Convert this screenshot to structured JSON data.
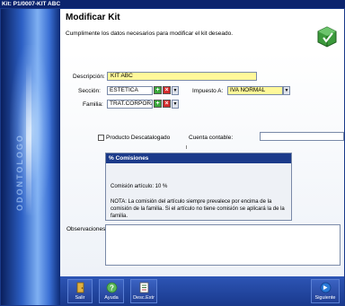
{
  "window": {
    "title": "Kit: P1/0007-KIT ABC"
  },
  "side_panel": {
    "watermark": "ODONTOLOGO"
  },
  "header": {
    "title": "Modificar Kit",
    "subtitle": "Cumplimente los datos necesarios para modificar el kit deseado."
  },
  "form": {
    "descripcion_label": "Descripción:",
    "descripcion_value": "KIT ABC",
    "seccion_label": "Sección:",
    "seccion_value": "ESTETICA",
    "impuesto_label": "Impuesto A:",
    "impuesto_value": "IVA NORMAL",
    "familia_label": "Familia:",
    "familia_value": "TRAT.CORPORAL",
    "descatalogado_label": "Producto Descatalogado",
    "descatalogado_checked": false,
    "cuenta_label": "Cuenta contable:",
    "cuenta_value": ""
  },
  "comisiones": {
    "title": "% Comisiones",
    "line": "Comisión artículo: 10 %",
    "note": "NOTA: La comisión del artículo siempre prevalece por encima de la comisión de la familia. Si el artículo no tiene comisión se aplicará la de la familia."
  },
  "observaciones": {
    "label": "Observaciones",
    "value": ""
  },
  "toolbar": {
    "salir_label": "Salir",
    "ayuda_label": "Ayuda",
    "desc_label": "Desc.Extr",
    "siguiente_label": "Siguiente"
  },
  "colors": {
    "accent_header": "#1b3a8a",
    "required_field": "#fff89a",
    "add": "#3aa63a",
    "delete": "#d22b2b"
  },
  "icons": [
    "kit-icon",
    "user-icon",
    "add-icon",
    "delete-icon",
    "dropdown-icon",
    "exit-door-icon",
    "help-icon",
    "document-list-icon",
    "next-arrow-icon"
  ]
}
